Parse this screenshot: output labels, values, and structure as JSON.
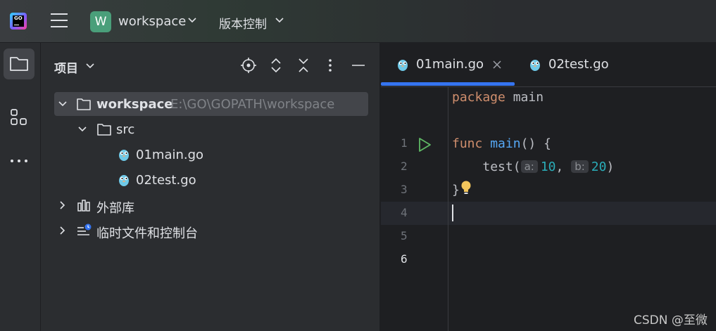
{
  "titlebar": {
    "logo_text": "GO",
    "workspace_badge": "W",
    "workspace_name": "workspace",
    "vcs_label": "版本控制"
  },
  "project_panel": {
    "title": "项目",
    "tree": {
      "root_name": "workspace",
      "root_path": "E:\\GO\\GOPATH\\workspace",
      "src_name": "src",
      "file1": "01main.go",
      "file2": "02test.go",
      "external_libs": "外部库",
      "scratches": "临时文件和控制台"
    }
  },
  "editor": {
    "tabs": [
      {
        "label": "01main.go",
        "active": true
      },
      {
        "label": "02test.go",
        "active": false
      }
    ],
    "line_numbers": [
      "1",
      "2",
      "3",
      "4",
      "5",
      "6"
    ],
    "current_line": "6",
    "code": {
      "l1_kw": "package",
      "l1_name": "main",
      "l3_kw": "func",
      "l3_name": "main",
      "l3_rest": "() {",
      "l4_call": "test",
      "l4_open": "(",
      "l4_hint_a": "a:",
      "l4_val_a": "10",
      "l4_comma": ",",
      "l4_hint_b": "b:",
      "l4_val_b": "20",
      "l4_close": ")",
      "l5": "}"
    }
  },
  "watermark": "CSDN @至微",
  "colors": {
    "accent": "#3574f0",
    "keyword": "#cf8e6d",
    "function": "#56a8f5",
    "number": "#2aacb8",
    "badge": "#4a9f7a"
  },
  "icons": [
    "app-logo-icon",
    "hamburger-menu-icon",
    "chevron-down-icon",
    "folder-icon",
    "structure-icon",
    "more-icon",
    "locate-icon",
    "expand-all-icon",
    "collapse-all-icon",
    "options-icon",
    "minimize-icon",
    "gopher-file-icon",
    "library-icon",
    "scratches-icon",
    "run-icon",
    "bulb-icon",
    "close-icon"
  ]
}
